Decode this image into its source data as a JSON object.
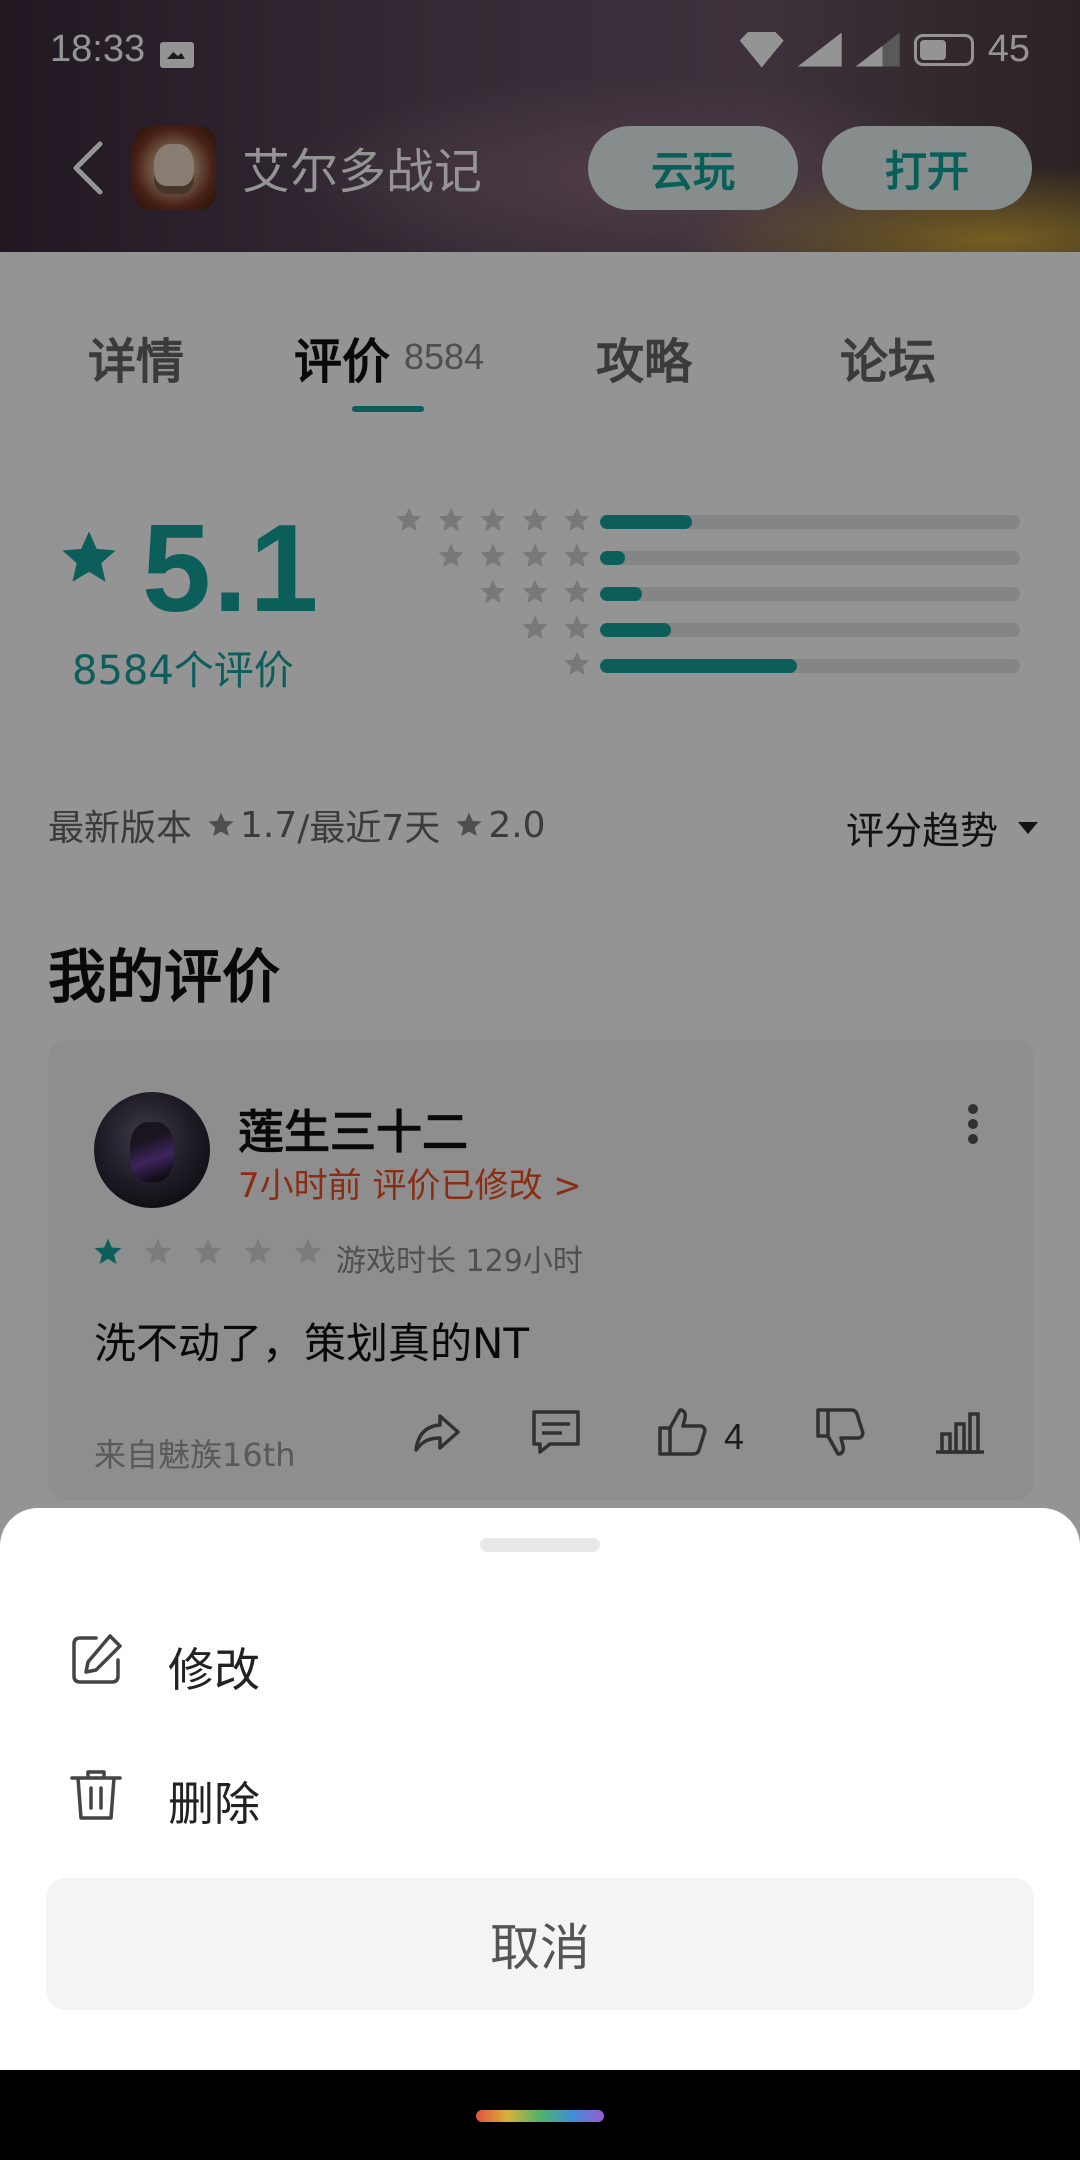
{
  "status_bar": {
    "time": "18:33",
    "battery": "45",
    "network": "4G"
  },
  "header": {
    "app_title": "艾尔多战记",
    "cloud_play": "云玩",
    "open": "打开"
  },
  "tabs": [
    {
      "label": "详情"
    },
    {
      "label": "评价",
      "count": "8584"
    },
    {
      "label": "攻略"
    },
    {
      "label": "论坛"
    }
  ],
  "rating": {
    "score": "5.1",
    "count_text": "8584个评价",
    "distribution": [
      {
        "stars": 5,
        "fraction": 0.22
      },
      {
        "stars": 4,
        "fraction": 0.06
      },
      {
        "stars": 3,
        "fraction": 0.1
      },
      {
        "stars": 2,
        "fraction": 0.17
      },
      {
        "stars": 1,
        "fraction": 0.47
      }
    ],
    "accent_color": "#14a39b"
  },
  "version_row": {
    "latest_label": "最新版本",
    "latest_score": "1.7",
    "separator": "/最近7天",
    "recent_score": "2.0",
    "trend_label": "评分趋势"
  },
  "my_review": {
    "section_title": "我的评价",
    "reviewer_name": "莲生三十二",
    "time_text": "7小时前 评价已修改 >",
    "stars": 1,
    "play_time": "游戏时长 129小时",
    "text": "洗不动了，策划真的NT",
    "source": "来自魅族16th",
    "like_count": "4"
  },
  "sheet": {
    "edit_label": "修改",
    "delete_label": "删除",
    "cancel_label": "取消"
  }
}
